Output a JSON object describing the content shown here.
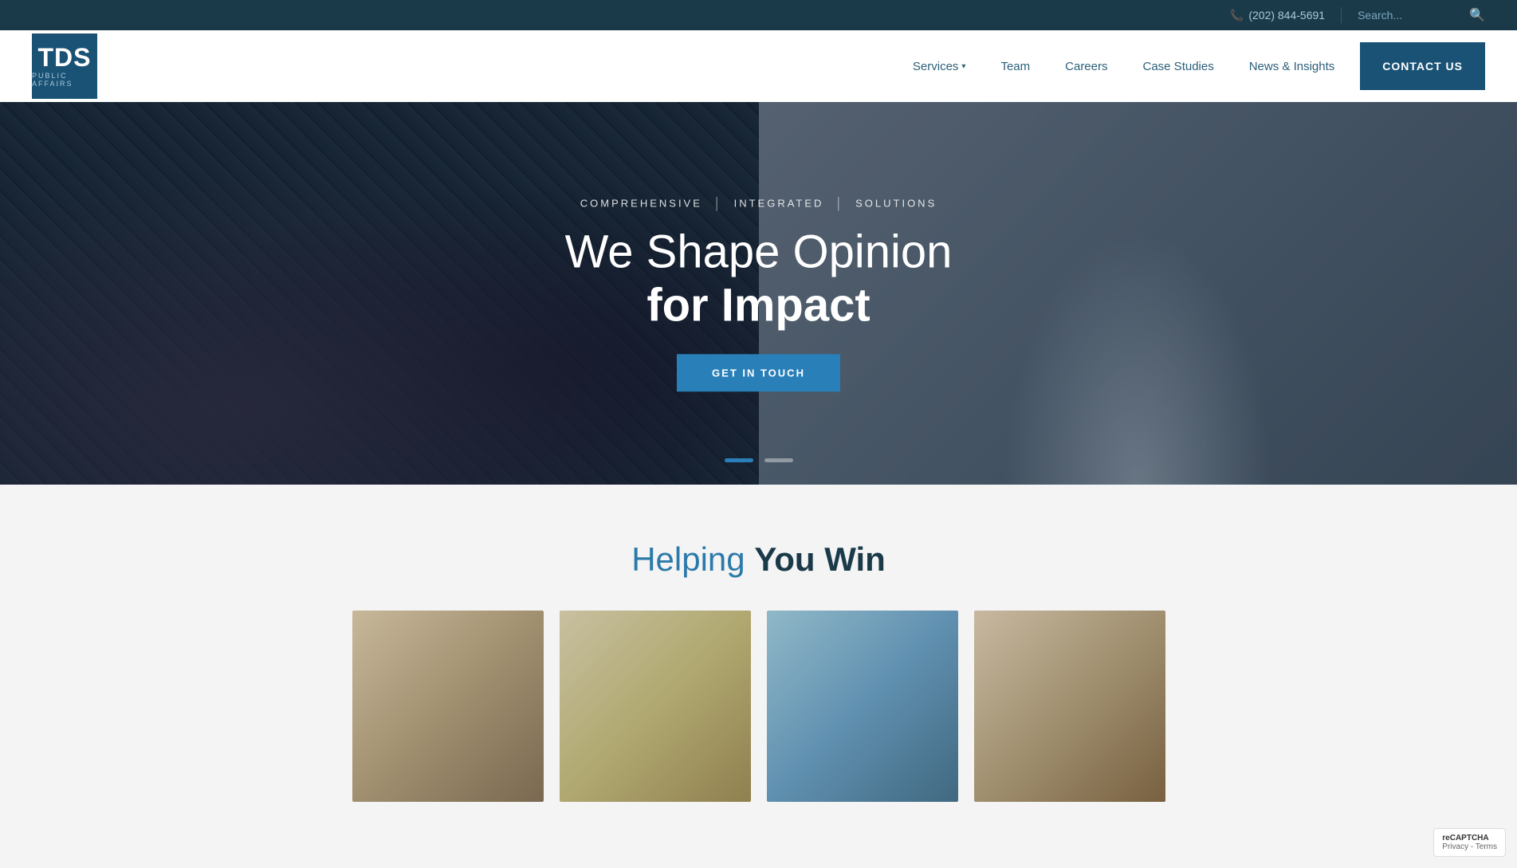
{
  "topbar": {
    "phone": "(202) 844-5691",
    "search_placeholder": "Search..."
  },
  "logo": {
    "text": "TDS",
    "subtitle": "PUBLIC AFFAIRS"
  },
  "nav": {
    "items": [
      {
        "label": "Services",
        "has_dropdown": true
      },
      {
        "label": "Team",
        "has_dropdown": false
      },
      {
        "label": "Careers",
        "has_dropdown": false
      },
      {
        "label": "Case Studies",
        "has_dropdown": false
      },
      {
        "label": "News & Insights",
        "has_dropdown": false
      }
    ],
    "contact_label": "CONTACT US"
  },
  "hero": {
    "tagline_parts": [
      "COMPREHENSIVE",
      "INTEGRATED",
      "SOLUTIONS"
    ],
    "title_regular": "We Shape Opinion",
    "title_bold": "for Impact",
    "cta_label": "GET IN TOUCH",
    "dots": [
      {
        "active": true
      },
      {
        "active": false
      }
    ]
  },
  "helping_section": {
    "title_regular": "Helping ",
    "title_bold": "You Win"
  },
  "cards": [
    {
      "id": 1
    },
    {
      "id": 2
    },
    {
      "id": 3
    },
    {
      "id": 4
    }
  ],
  "recaptcha": {
    "label": "reCAPTCHA",
    "sub": "Privacy - Terms"
  }
}
